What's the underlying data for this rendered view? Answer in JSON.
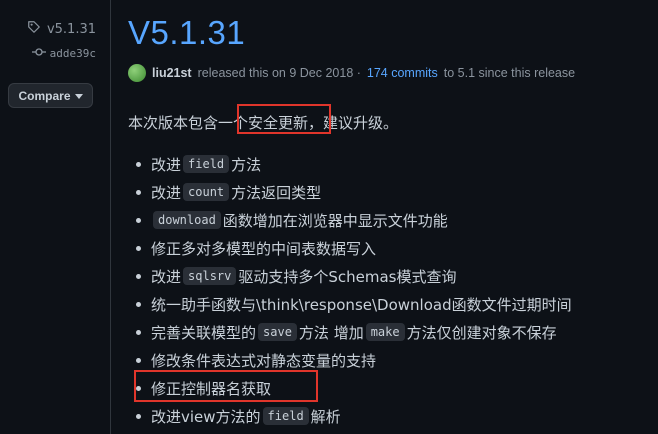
{
  "meta": {
    "tag": "v5.1.31",
    "commit": "adde39c",
    "compare_label": "Compare"
  },
  "release": {
    "version": "V5.1.31",
    "author": "liu21st",
    "released_text": "released this on 9 Dec 2018 ·",
    "commits_link": "174 commits",
    "since_text": "to 5.1 since this release"
  },
  "notes": {
    "intro": "本次版本包含一个安全更新，建议升级。",
    "items": [
      {
        "pre": "改进",
        "code": "field",
        "post": "方法"
      },
      {
        "pre": "改进",
        "code": "count",
        "post": "方法返回类型"
      },
      {
        "pre": "",
        "code": "download",
        "post": "函数增加在浏览器中显示文件功能"
      },
      {
        "pre": "修正多对多模型的中间表数据写入",
        "code": "",
        "post": ""
      },
      {
        "pre": "改进",
        "code": "sqlsrv",
        "post": "驱动支持多个Schemas模式查询"
      },
      {
        "pre": "统一助手函数与\\think\\response\\Download函数文件过期时间",
        "code": "",
        "post": ""
      },
      {
        "pre": "完善关联模型的",
        "code": "save",
        "post": "方法 增加",
        "code2": "make",
        "post2": "方法仅创建对象不保存"
      },
      {
        "pre": "修改条件表达式对静态变量的支持",
        "code": "",
        "post": ""
      },
      {
        "pre": "修正控制器名获取",
        "code": "",
        "post": ""
      },
      {
        "pre": "改进view方法的",
        "code": "field",
        "post": "解析"
      }
    ]
  },
  "colors": {
    "background": "#0d1117",
    "link": "#58a6ff",
    "highlight_box": "#e0352b"
  }
}
